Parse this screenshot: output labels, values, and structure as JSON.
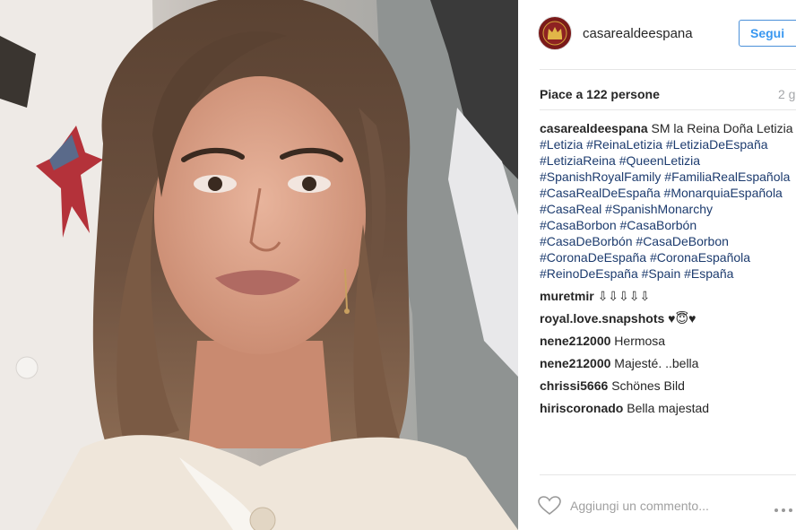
{
  "post": {
    "account": {
      "username": "casarealdeespana",
      "avatar_icon": "crown-logo-icon",
      "avatar_color": "#7a1a1a"
    },
    "follow_label": "Segui",
    "likes_text": "Piace a 122 persone",
    "time_text": "2 g",
    "caption": {
      "author": "casarealdeespana",
      "text": "SM la Reina Doña Letizia",
      "hashtags": [
        "#Letizia",
        "#ReinaLetizia",
        "#LetiziaDeEspaña",
        "#LetiziaReina",
        "#QueenLetizia",
        "#SpanishRoyalFamily",
        "#FamiliaRealEspañola",
        "#CasaRealDeEspaña",
        "#MonarquiaEspañola",
        "#CasaReal",
        "#SpanishMonarchy",
        "#CasaBorbon",
        "#CasaBorbón",
        "#CasaDeBorbón",
        "#CasaDeBorbon",
        "#CoronaDeEspaña",
        "#CoronaEspañola",
        "#ReinoDeEspaña",
        "#Spain",
        "#España"
      ]
    },
    "comments": [
      {
        "author": "muretmir",
        "text": "⇩⇩⇩⇩⇩"
      },
      {
        "author": "royal.love.snapshots",
        "text": "♥😇♥"
      },
      {
        "author": "nene212000",
        "text": "Hermosa"
      },
      {
        "author": "nene212000",
        "text": "Majesté. ..bella"
      },
      {
        "author": "chrissi5666",
        "text": "Schönes Bild"
      },
      {
        "author": "hiriscoronado",
        "text": "Bella majestad"
      }
    ],
    "comment_placeholder": "Aggiungi un commento...",
    "colors": {
      "accent": "#3897f0",
      "hashtag": "#1c3b6e",
      "muted": "#a5a7aa"
    }
  }
}
